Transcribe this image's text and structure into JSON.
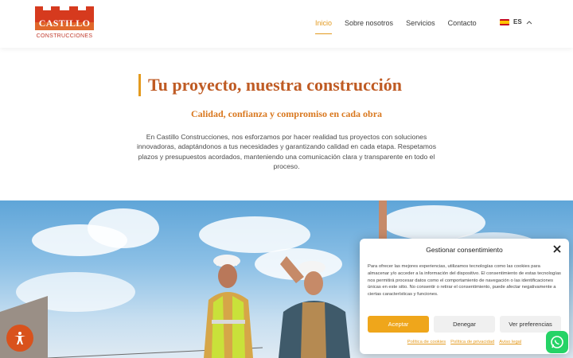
{
  "brand": {
    "logo_name": "CASTILLO",
    "logo_sub": "CONSTRUCCIONES",
    "accent": "#e39a1f",
    "heading_color": "#bf5b24",
    "logo_red": "#d63a1e"
  },
  "nav": {
    "items": [
      {
        "label": "Inicio",
        "active": true
      },
      {
        "label": "Sobre nosotros",
        "active": false
      },
      {
        "label": "Servicios",
        "active": false
      },
      {
        "label": "Contacto",
        "active": false
      }
    ],
    "language": {
      "label": "ES",
      "flag": "spain-flag-icon"
    }
  },
  "hero": {
    "title": "Tu proyecto, nuestra construcción",
    "subtitle": "Calidad, confianza y compromiso en cada obra",
    "paragraph": "En Castillo Construcciones, nos esforzamos por hacer realidad tus proyectos con soluciones innovadoras, adaptándonos a tus necesidades y garantizando calidad en cada etapa. Respetamos plazos y presupuestos acordados, manteniendo una comunicación clara y transparente en todo el proceso."
  },
  "photo": {
    "subject": "construction-workers-photo"
  },
  "consent": {
    "title": "Gestionar consentimiento",
    "text": "Para ofrecer las mejores experiencias, utilizamos tecnologías como las cookies para almacenar y/o acceder a la información del dispositivo. El consentimiento de estas tecnologías nos permitirá procesar datos como el comportamiento de navegación o las identificaciones únicas en este sitio. No consentir o retirar el consentimiento, puede afectar negativamente a ciertas características y funciones.",
    "accept_label": "Aceptar",
    "deny_label": "Denegar",
    "prefs_label": "Ver preferencias",
    "links": [
      "Política de cookies",
      "Política de privacidad",
      "Aviso legal"
    ]
  },
  "floating": {
    "accessibility_icon": "accessibility-icon",
    "whatsapp_icon": "whatsapp-icon"
  }
}
